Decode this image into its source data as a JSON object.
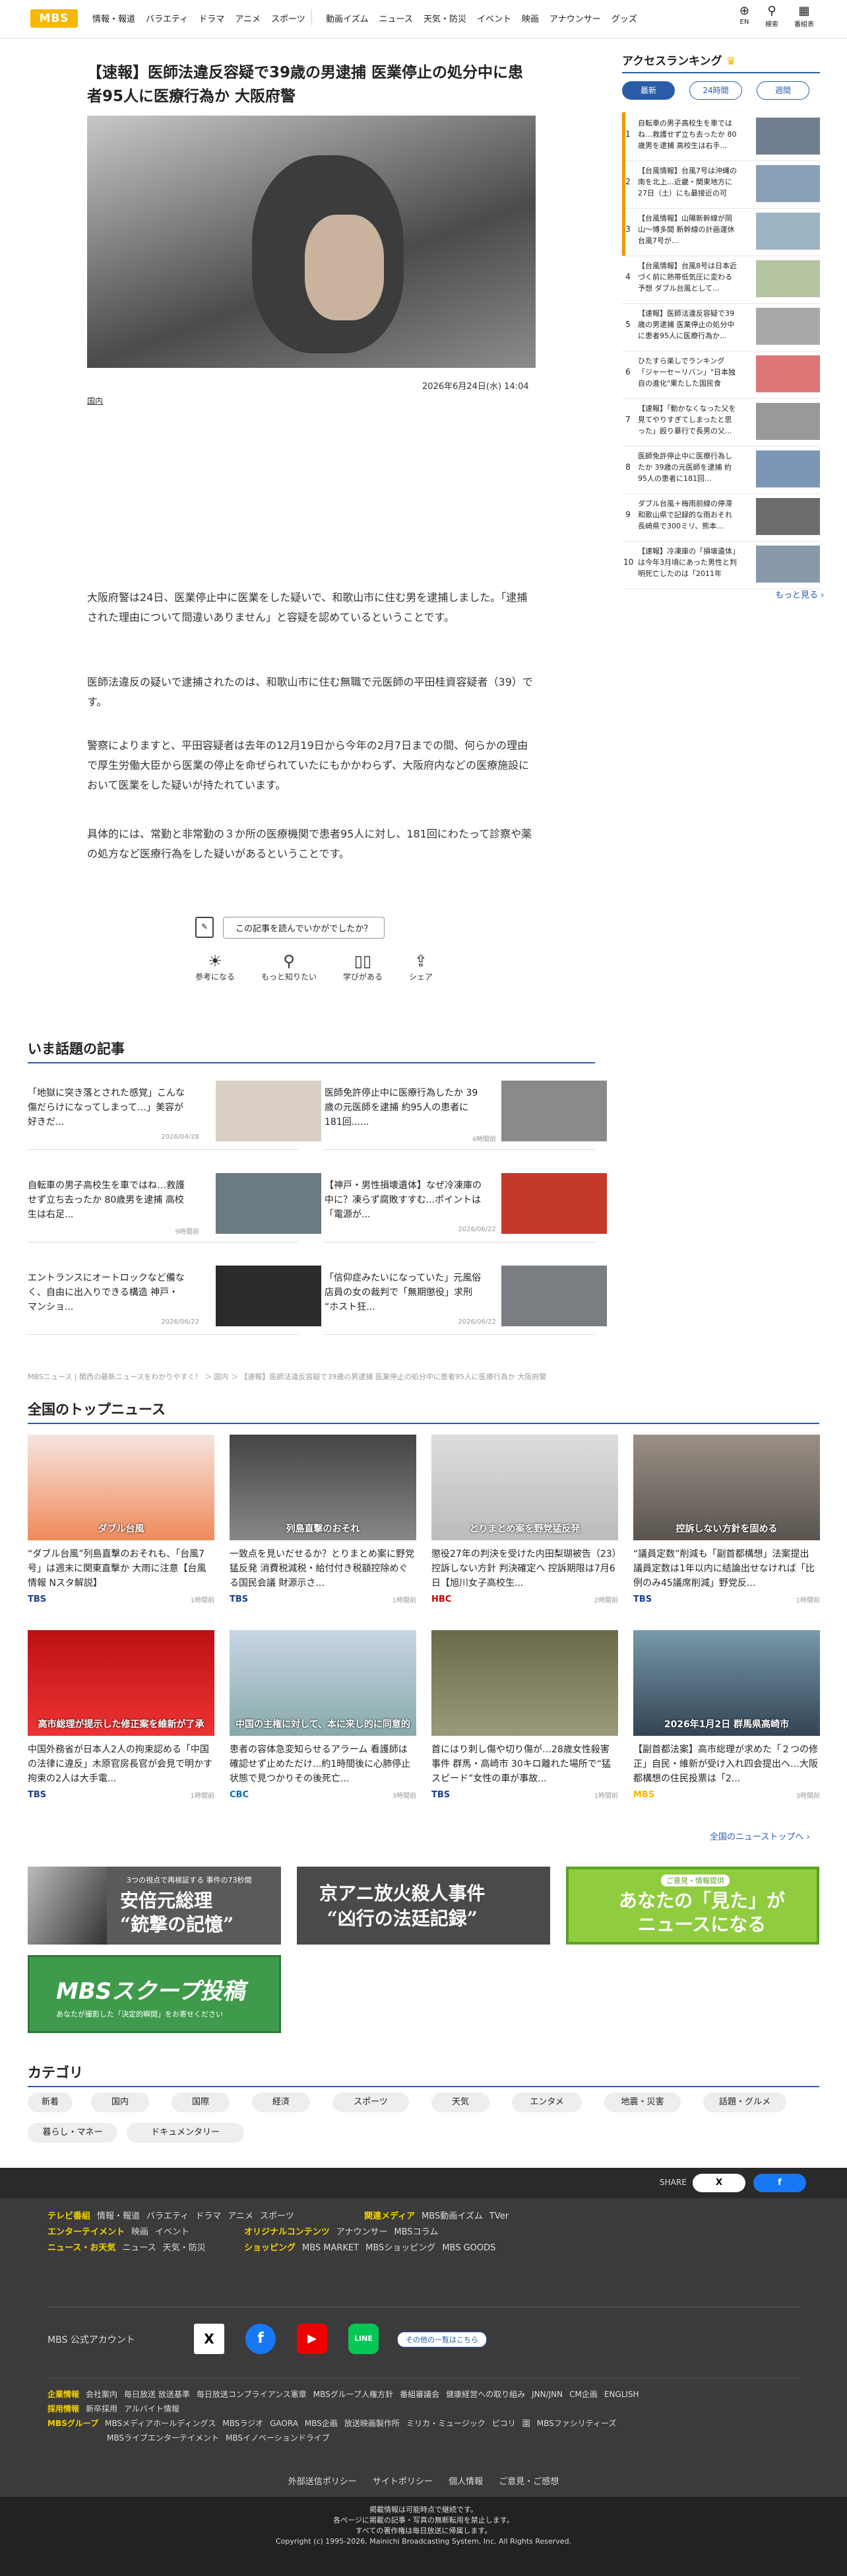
{
  "header": {
    "logo": "MBS",
    "nav": [
      "情報・報道",
      "バラエティ",
      "ドラマ",
      "アニメ",
      "スポーツ",
      "動画イズム",
      "ニュース",
      "天気・防災",
      "イベント",
      "映画",
      "アナウンサー",
      "グッズ"
    ],
    "icons": [
      {
        "label": "EN",
        "icon": "globe-icon"
      },
      {
        "label": "検索",
        "icon": "search-icon"
      },
      {
        "label": "番組表",
        "icon": "calendar-icon"
      }
    ]
  },
  "article": {
    "title": "【速報】医師法違反容疑で39歳の男逮捕 医業停止の処分中に患者95人に医療行為か 大阪府警",
    "date": "2026年6月24日(水) 14:04",
    "category": "国内",
    "paragraphs": [
      "大阪府警は24日、医業停止中に医業をした疑いで、和歌山市に住む男を逮捕しました。「逮捕された理由について間違いありません」と容疑を認めているということです。",
      "医師法違反の疑いで逮捕されたのは、和歌山市に住む無職で元医師の平田桂資容疑者（39）です。",
      "警察によりますと、平田容疑者は去年の12月19日から今年の2月7日までの間、何らかの理由で厚生労働大臣から医業の停止を命ぜられていたにもかかわらず、大阪府内などの医療施設において医業をした疑いが持たれています。",
      "具体的には、常勤と非常勤の３か所の医療機関で患者95人に対し、181回にわたって診察や薬の処方など医療行為をした疑いがあるということです。"
    ],
    "feedback": "この記事を読んでいかがでしたか？",
    "reactions": [
      {
        "label": "参考になる",
        "icon": "bulb-icon"
      },
      {
        "label": "もっと知りたい",
        "icon": "search-icon"
      },
      {
        "label": "学びがある",
        "icon": "book-icon"
      },
      {
        "label": "シェア",
        "icon": "share-icon"
      }
    ]
  },
  "ranking": {
    "title": "アクセスランキング",
    "tabs": [
      "最新",
      "24時間",
      "週間"
    ],
    "more": "もっと見る ›",
    "items": [
      {
        "n": "1",
        "t": "自転車の男子高校生を車ではね…救護せず立ち去ったか 80歳男を逮捕 高校生は右手..."
      },
      {
        "n": "2",
        "t": "【台風情報】台風7号は沖縄の南を北上…近畿・関東地方に27日（土）にも最接近の可能..."
      },
      {
        "n": "3",
        "t": "【台風情報】山陽新幹線が岡山〜博多間 新幹線の計画運休 台風7号が..."
      },
      {
        "n": "4",
        "t": "【台風情報】台風8号は日本近づく前に熱帯低気圧に変わる予想 ダブル台風として..."
      },
      {
        "n": "5",
        "t": "【速報】医師法違反容疑で39歳の男逮捕 医業停止の処分中に患者95人に医療行為か..."
      },
      {
        "n": "6",
        "t": "ひたすら楽しでランキング「ジャーセーリバン」\"日本独自の進化\"果たした国民食 を..."
      },
      {
        "n": "7",
        "t": "【速報】「動かなくなった父を見てやりすぎてしまったと思った」殴り暴行で長男の父..."
      },
      {
        "n": "8",
        "t": "医師免許停止中に医療行為したか 39歳の元医師を逮捕 約95人の患者に181回..."
      },
      {
        "n": "9",
        "t": "ダブル台風＋梅雨前線の停滞 和歌山県で記録的な雨おそれ 長崎県で300ミリ、熊本..."
      },
      {
        "n": "10",
        "t": "【速報】冷凍庫の「損壊遺体」は今年3月頃にあった男性と判明死亡したのは「2011年12..."
      }
    ]
  },
  "topics": {
    "title": "いま話題の記事",
    "items": [
      {
        "t": "「地獄に突き落とされた感覚」こんな傷だらけになってしまって…」美容が好きだ...",
        "d": "2026/04/28"
      },
      {
        "t": "医師免許停止中に医療行為したか 39歳の元医師を逮捕 約95人の患者に181回......",
        "d": "4時間前"
      },
      {
        "t": "自転車の男子高校生を車ではね…救護せず立ち去ったか 80歳男を逮捕 高校生は右足...",
        "d": "9時間前"
      },
      {
        "t": "【神戸・男性損壊遺体】なぜ冷凍庫の中に？凍らず腐敗すすむ...ポイントは「電源が...",
        "d": "2026/06/22"
      },
      {
        "t": "エントランスにオートロックなど備なく、自由に出入りできる構造 神戸・マンショ...",
        "d": "2026/06/22"
      },
      {
        "t": "「信仰症みたいになっていた」元風俗店員の女の裁判で「無期懲役」求刑 “ホスト狂...",
        "d": "2026/06/22"
      }
    ]
  },
  "breadcrumb": "MBSニュース | 関西の最新ニュースをわかりやすく！ ＞ 国内 ＞ 【速報】医師法違反容疑で39歳の男逮捕 医業停止の処分中に患者95人に医療行為か 大阪府警",
  "national": {
    "title": "全国のトップニュース",
    "more": "全国のニューストップへ ›",
    "items": [
      {
        "t": "“ダブル台風”列島直撃のおそれも、「台風7号」は週末に関東直撃か 大雨に注意【台風情報 Nスタ解説】",
        "src": "TBS",
        "d": "1時間前"
      },
      {
        "t": "一致点を見いだせるか？とりまとめ案に野党猛反発 消費税減税・給付付き税額控除めぐる国民会議 財源示さ...",
        "src": "TBS",
        "d": "1時間前"
      },
      {
        "t": "懲役27年の判決を受けた内田梨瑚被告（23）控訴しない方針 判決確定へ 控訴期限は7月6日【旭川女子高校生...",
        "src": "HBC",
        "d": "2時間前"
      },
      {
        "t": "“議員定数”削減も「副首都構想」法案提出 議員定数は1年以内に結論出せなければ「比例のみ45議席削減」野党反...",
        "src": "TBS",
        "d": "1時間前"
      },
      {
        "t": "中国外務省が日本人2人の拘束認める「中国の法律に違反」木原官房長官が会見で明かす 拘束の2人は大手電...",
        "src": "TBS",
        "d": "1時間前"
      },
      {
        "t": "患者の容体急変知らせるアラーム 看護師は確認せず止めただけ...約1時間後に心肺停止状態で見つかりその後死亡...",
        "src": "CBC",
        "d": "3時間前"
      },
      {
        "t": "首にはり刺し傷や切り傷が…28歳女性殺害事件 群馬・高崎市 30キロ離れた場所で“猛スピード”女性の車が事故...",
        "src": "TBS",
        "d": "1時間前"
      },
      {
        "t": "【副首都法案】高市総理が求めた「２つの修正」自民・維新が受け入れ四会提出へ…大阪都構想の住民投票は「2...",
        "src": "MBS",
        "d": "3時間前"
      }
    ],
    "img_texts": [
      "ダブル台風",
      "列島直撃のおそれ",
      "とりまとめ案を野党猛反発",
      "控訴しない方針を固める",
      "高市総理が提示した修正案を維新が了承",
      "中国の主権に対して、本に来し的に同意的",
      "",
      "2026年1月2日 群馬県高崎市",
      ""
    ]
  },
  "banners": [
    {
      "main": "安倍元総理\n“銃撃の記憶”",
      "sub": "3つの視点で再検証する 事件の73秒間"
    },
    {
      "main": "京アニ放火殺人事件\n“凶行の法廷記録”",
      "sub": ""
    },
    {
      "main": "あなたの「見た」が\nニュースになる",
      "sub": "ご意見・情報提供"
    },
    {
      "main": "MBSスクープ投稿",
      "sub": "あなたが撮影した「決定的瞬間」をお寄せください"
    }
  ],
  "categories": {
    "title": "カテゴリ",
    "items": [
      "新着",
      "国内",
      "国際",
      "経済",
      "スポーツ",
      "天気",
      "エンタメ",
      "地震・災害",
      "話題・グルメ",
      "暮らし・マネー",
      "ドキュメンタリー"
    ]
  },
  "footer": {
    "share": "SHARE",
    "share_x": "X",
    "share_fb": "f",
    "rows": [
      [
        "テレビ番組",
        "情報・報道",
        "バラエティ",
        "ドラマ",
        "アニメ",
        "スポーツ"
      ],
      [
        "関連メディア",
        "MBS動画イズム",
        "TVer"
      ],
      [
        "エンターテイメント",
        "映画",
        "イベント"
      ],
      [
        "オリジナルコンテンツ",
        "アナウンサー",
        "MBSコラム"
      ],
      [
        "ニュース・お天気",
        "ニュース",
        "天気・防災"
      ],
      [
        "ショッピング",
        "MBS MARKET",
        "MBSショッピング",
        "MBS GOODS"
      ]
    ],
    "official": "MBS 公式アカウント",
    "others": "その他の一覧はこちら",
    "corp": [
      [
        "企業情報",
        "会社案内",
        "毎日放送 放送基準",
        "毎日放送コンプライアンス憲章",
        "MBSグループ人権方針",
        "番組審議会",
        "健康経営への取り組み",
        "JNN/JNN",
        "CM企画",
        "ENGLISH"
      ],
      [
        "採用情報",
        "新卒採用",
        "アルバイト情報"
      ],
      [
        "MBSグループ",
        "MBSメディアホールディングス",
        "MBSラジオ",
        "GAORA",
        "MBS企画",
        "放送映画製作所",
        "ミリカ・ミュージック",
        "ピコリ",
        "園",
        "MBSファシリティーズ"
      ],
      [
        "",
        "MBSライブエンターテイメント",
        "MBSイノベーションドライブ"
      ]
    ],
    "policy": [
      "外部送信ポリシー",
      "サイトポリシー",
      "個人情報",
      "ご意見・ご感想"
    ],
    "copy1": "掲載情報は可能時点で継続です。",
    "copy2": "各ページに掲載の記事・写真の無断転用を禁止します。",
    "copy3": "すべての著作権は毎日放送に帰属します。",
    "copyright": "Copyright (c) 1995-2026, Mainichi Broadcasting System, Inc. All Rights Reserved."
  },
  "colors": {
    "accent": "#2a5caa",
    "brand": "#f6b800",
    "footer": "#3b3b3b",
    "footer_link": "#f6d200"
  }
}
